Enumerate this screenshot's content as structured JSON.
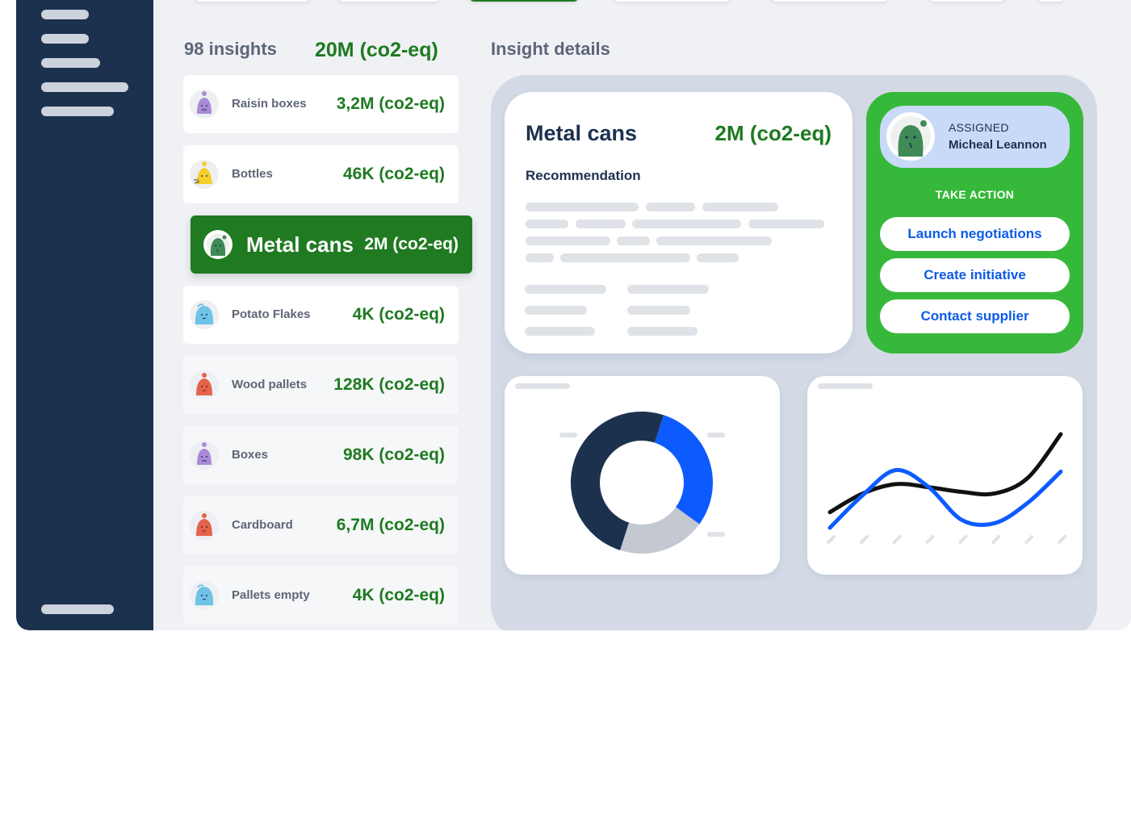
{
  "list": {
    "count_label": "98 insights",
    "total": "20M (co2-eq)",
    "items": [
      {
        "name": "Raisin boxes",
        "value": "3,2M (co2-eq)",
        "avatar_color": "#a98ad6",
        "icon": "purple-blob-icon"
      },
      {
        "name": "Bottles",
        "value": "46K (co2-eq)",
        "avatar_color": "#f2cf2b",
        "icon": "yellow-blob-icon"
      },
      {
        "name": "Metal cans",
        "value": "2M (co2-eq)",
        "avatar_color": "#3f8a55",
        "icon": "green-blob-icon",
        "selected": true
      },
      {
        "name": "Potato Flakes",
        "value": "4K (co2-eq)",
        "avatar_color": "#6fc3e6",
        "icon": "blue-blob-icon"
      },
      {
        "name": "Wood pallets",
        "value": "128K (co2-eq)",
        "avatar_color": "#e5624b",
        "icon": "red-blob-icon"
      },
      {
        "name": "Boxes",
        "value": "98K (co2-eq)",
        "avatar_color": "#a98ad6",
        "icon": "purple-blob-icon"
      },
      {
        "name": "Cardboard",
        "value": "6,7M (co2-eq)",
        "avatar_color": "#e5624b",
        "icon": "red-blob-icon"
      },
      {
        "name": "Pallets empty",
        "value": "4K (co2-eq)",
        "avatar_color": "#6fc3e6",
        "icon": "blue-blob-icon"
      }
    ]
  },
  "details": {
    "header": "Insight details",
    "title": "Metal cans",
    "value": "2M (co2-eq)",
    "recommendation_label": "Recommendation"
  },
  "assignment": {
    "label": "ASSIGNED",
    "name": "Micheal Leannon",
    "take_action": "TAKE ACTION",
    "actions": [
      "Launch negotiations",
      "Create initiative",
      "Contact supplier"
    ]
  },
  "colors": {
    "brand_green": "#1e7a21",
    "action_green": "#36b93a",
    "navy": "#1c314e",
    "link_blue": "#0d5be8"
  },
  "chart_data": [
    {
      "type": "pie",
      "title": "",
      "values": [
        30,
        20,
        50
      ],
      "colors": [
        "#0d5bff",
        "#c4c8d0",
        "#1c314e"
      ]
    },
    {
      "type": "line",
      "title": "",
      "x": [
        0,
        1,
        2,
        3,
        4,
        5,
        6,
        7
      ],
      "series": [
        {
          "values": [
            1,
            2.2,
            2.8,
            2.6,
            2.3,
            2.2,
            3.2,
            6.0
          ],
          "color": "#111111"
        },
        {
          "values": [
            0,
            2.1,
            3.7,
            2.6,
            0.5,
            0.3,
            1.6,
            3.6
          ],
          "color": "#0d5bff"
        }
      ]
    }
  ]
}
